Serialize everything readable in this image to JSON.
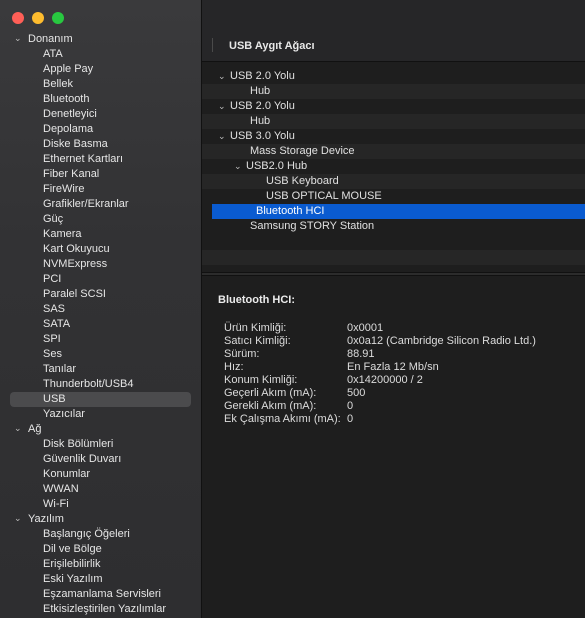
{
  "sidebar": {
    "groups": [
      {
        "label": "Donanım",
        "items": [
          "ATA",
          "Apple Pay",
          "Bellek",
          "Bluetooth",
          "Denetleyici",
          "Depolama",
          "Diske Basma",
          "Ethernet Kartları",
          "Fiber Kanal",
          "FireWire",
          "Grafikler/Ekranlar",
          "Güç",
          "Kamera",
          "Kart Okuyucu",
          "NVMExpress",
          "PCI",
          "Paralel SCSI",
          "SAS",
          "SATA",
          "SPI",
          "Ses",
          "Tanılar",
          "Thunderbolt/USB4",
          "USB",
          "Yazıcılar"
        ]
      },
      {
        "label": "Ağ",
        "items": [
          "Disk Bölümleri",
          "Güvenlik Duvarı",
          "Konumlar",
          "WWAN",
          "Wi-Fi"
        ]
      },
      {
        "label": "Yazılım",
        "items": [
          "Başlangıç Öğeleri",
          "Dil ve Bölge",
          "Erişilebilirlik",
          "Eski Yazılım",
          "Eşzamanlama Servisleri",
          "Etkisizleştirilen Yazılımlar"
        ]
      }
    ],
    "selected": "USB"
  },
  "main": {
    "title": "USB Aygıt Ağacı",
    "devices": [
      {
        "label": "USB 2.0 Yolu",
        "level": 0,
        "chevron": true
      },
      {
        "label": "Hub",
        "level": 1,
        "chevron": false
      },
      {
        "label": "USB 2.0 Yolu",
        "level": 0,
        "chevron": true
      },
      {
        "label": "Hub",
        "level": 1,
        "chevron": false
      },
      {
        "label": "USB 3.0 Yolu",
        "level": 0,
        "chevron": true
      },
      {
        "label": "Mass Storage Device",
        "level": 1,
        "chevron": false
      },
      {
        "label": "USB2.0 Hub",
        "level": 1,
        "chevron": true
      },
      {
        "label": "USB Keyboard",
        "level": 2,
        "chevron": false
      },
      {
        "label": "USB OPTICAL MOUSE",
        "level": 2,
        "chevron": false
      },
      {
        "label": "Bluetooth HCI",
        "level": 1,
        "chevron": false,
        "selected": true
      },
      {
        "label": "Samsung STORY Station",
        "level": 1,
        "chevron": false
      }
    ],
    "detail": {
      "heading": "Bluetooth HCI:",
      "properties": [
        {
          "key": "Ürün Kimliği:",
          "value": "0x0001"
        },
        {
          "key": "Satıcı Kimliği:",
          "value": "0x0a12  (Cambridge Silicon Radio Ltd.)"
        },
        {
          "key": "Sürüm:",
          "value": "88.91"
        },
        {
          "key": "Hız:",
          "value": "En Fazla 12 Mb/sn"
        },
        {
          "key": "Konum Kimliği:",
          "value": "0x14200000 / 2"
        },
        {
          "key": "Geçerli Akım (mA):",
          "value": "500"
        },
        {
          "key": "Gerekli Akım (mA):",
          "value": "0"
        },
        {
          "key": "Ek Çalışma Akımı (mA):",
          "value": "0"
        }
      ]
    }
  },
  "colors": {
    "selection": "#0a5bd0",
    "sidebar_selection": "#4b4b4d",
    "close": "#ff5f57",
    "minimize": "#febc2e",
    "zoom": "#28c840"
  }
}
